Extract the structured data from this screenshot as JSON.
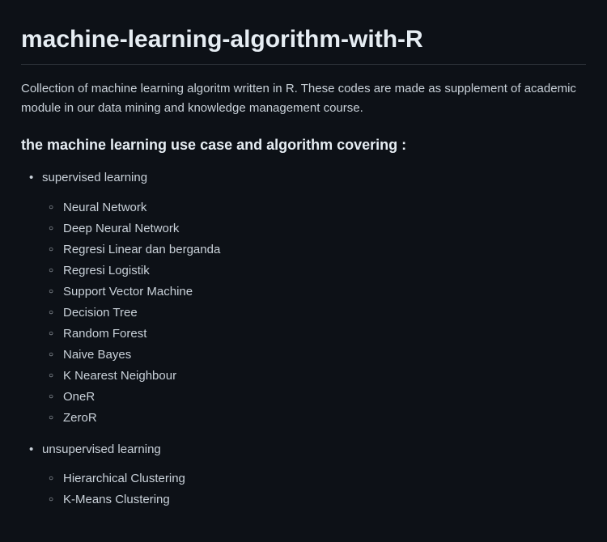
{
  "title": "machine-learning-algorithm-with-R",
  "description": "Collection of machine learning algoritm written in R. These codes are made as supplement of academic module in our data mining and knowledge management course.",
  "subheading": "the machine learning use case and algorithm covering :",
  "categories": [
    {
      "label": "supervised learning",
      "items": [
        "Neural Network",
        "Deep Neural Network",
        "Regresi Linear dan berganda",
        "Regresi Logistik",
        "Support Vector Machine",
        "Decision Tree",
        "Random Forest",
        "Naive Bayes",
        "K Nearest Neighbour",
        "OneR",
        "ZeroR"
      ]
    },
    {
      "label": "unsupervised learning",
      "items": [
        "Hierarchical Clustering",
        "K-Means Clustering"
      ]
    }
  ]
}
